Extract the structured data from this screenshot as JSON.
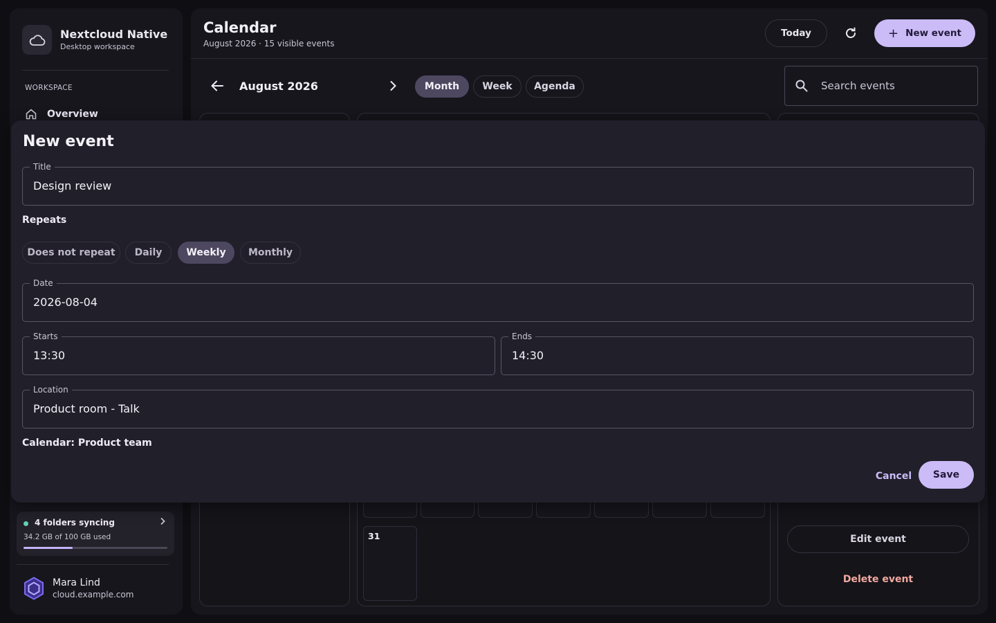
{
  "sidebar": {
    "brand_title": "Nextcloud Native",
    "brand_subtitle": "Desktop workspace",
    "section_label": "WORKSPACE",
    "items": [
      {
        "label": "Overview",
        "icon": "home-icon"
      }
    ],
    "sync": {
      "title": "4 folders syncing",
      "usage": "34.2 GB of 100 GB used",
      "used_fraction": 0.342,
      "status_color": "#62d3b0"
    },
    "user": {
      "name": "Mara Lind",
      "host": "cloud.example.com"
    }
  },
  "header": {
    "title": "Calendar",
    "subtitle": "August 2026 · 15 visible events",
    "today_label": "Today",
    "new_event_label": "New event",
    "refresh_icon": "refresh-icon"
  },
  "toolbar": {
    "month_label": "August 2026",
    "views": [
      {
        "label": "Month",
        "active": true
      },
      {
        "label": "Week",
        "active": false
      },
      {
        "label": "Agenda",
        "active": false
      }
    ],
    "search_placeholder": "Search events"
  },
  "calendar_grid": {
    "visible_day": "31"
  },
  "detail_panel": {
    "edit_label": "Edit event",
    "delete_label": "Delete event"
  },
  "modal": {
    "title": "New event",
    "title_field": {
      "label": "Title",
      "value": "Design review"
    },
    "repeats_label": "Repeats",
    "repeat_options": [
      {
        "label": "Does not repeat",
        "active": false
      },
      {
        "label": "Daily",
        "active": false
      },
      {
        "label": "Weekly",
        "active": true
      },
      {
        "label": "Monthly",
        "active": false
      }
    ],
    "date_field": {
      "label": "Date",
      "value": "2026-08-04"
    },
    "starts_field": {
      "label": "Starts",
      "value": "13:30"
    },
    "ends_field": {
      "label": "Ends",
      "value": "14:30"
    },
    "location_field": {
      "label": "Location",
      "value": "Product room - Talk"
    },
    "calendar_line": "Calendar: Product team",
    "cancel_label": "Cancel",
    "save_label": "Save"
  },
  "colors": {
    "accent": "#cbbcf7",
    "active_chip": "#4d4860",
    "danger": "#f2a9a0",
    "background": "#0f0f13",
    "surface": "#17161d",
    "modal": "#211f2a"
  }
}
